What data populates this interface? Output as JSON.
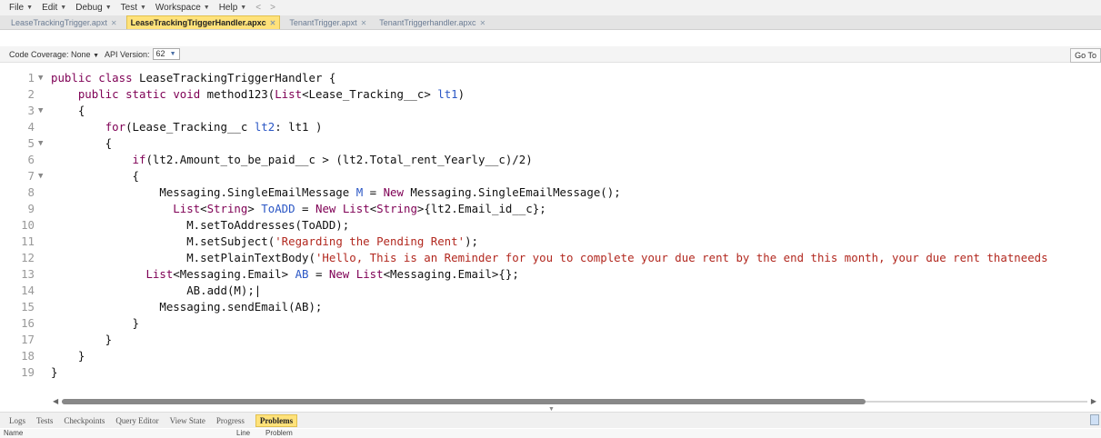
{
  "menu": {
    "items": [
      "File",
      "Edit",
      "Debug",
      "Test",
      "Workspace",
      "Help"
    ],
    "back": "<",
    "forward": ">"
  },
  "tabs": [
    {
      "label": "LeaseTrackingTrigger.apxt",
      "active": false
    },
    {
      "label": "LeaseTrackingTriggerHandler.apxc",
      "active": true
    },
    {
      "label": "TenantTrigger.apxt",
      "active": false
    },
    {
      "label": "TenantTriggerhandler.apxc",
      "active": false
    }
  ],
  "toolbar": {
    "coverage_label": "Code Coverage: None",
    "api_label": "API Version:",
    "api_value": "62",
    "goto_label": "Go To"
  },
  "editor": {
    "line_numbers": [
      "1",
      "2",
      "3",
      "4",
      "5",
      "6",
      "7",
      "8",
      "9",
      "10",
      "11",
      "12",
      "13",
      "14",
      "15",
      "16",
      "17",
      "18",
      "19"
    ],
    "folds": [
      "1",
      "3",
      "5",
      "7"
    ]
  },
  "bottom_tabs": [
    {
      "label": "Logs",
      "active": false
    },
    {
      "label": "Tests",
      "active": false
    },
    {
      "label": "Checkpoints",
      "active": false
    },
    {
      "label": "Query Editor",
      "active": false
    },
    {
      "label": "View State",
      "active": false
    },
    {
      "label": "Progress",
      "active": false
    },
    {
      "label": "Problems",
      "active": true
    }
  ],
  "problems_table": {
    "columns": [
      "Name",
      "Line",
      "Problem"
    ]
  },
  "colors": {
    "active_tab": "#ffe27a",
    "keyword": "#7f0055",
    "variable": "#2b57c5",
    "string": "#b2281f"
  }
}
